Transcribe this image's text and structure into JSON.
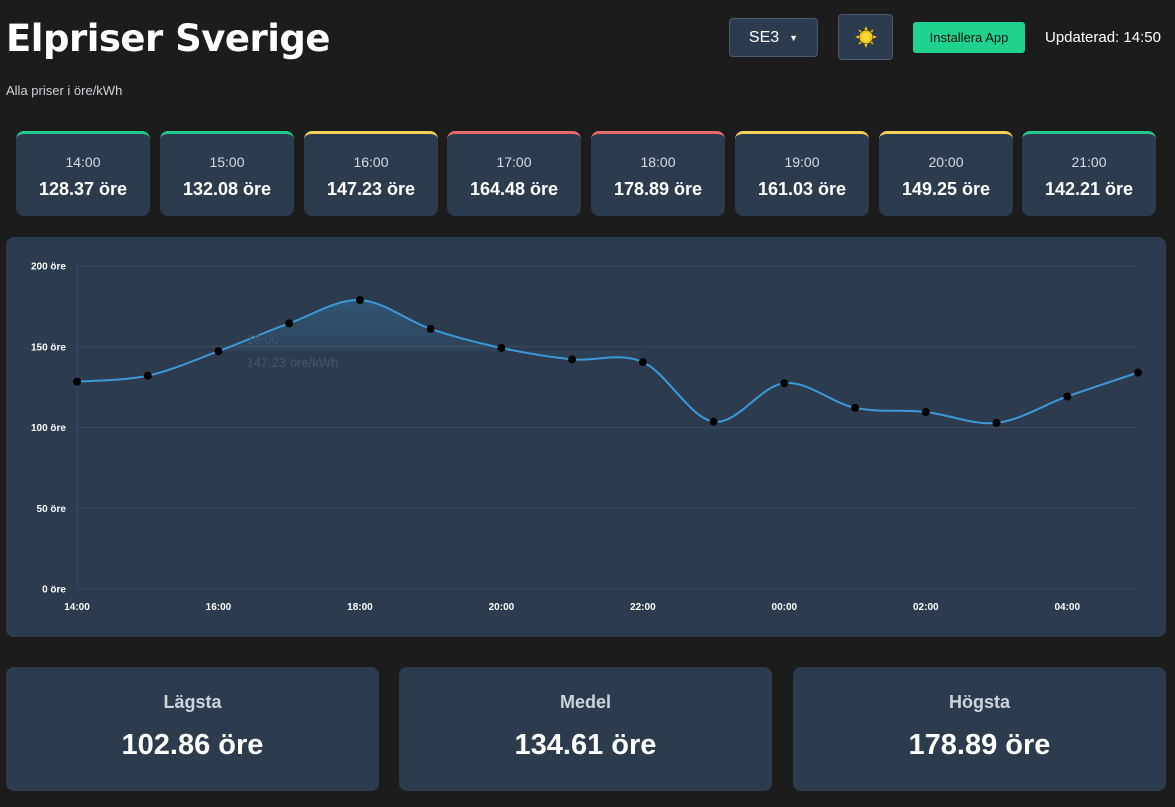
{
  "header": {
    "title": "Elpriser Sverige",
    "subtitle": "Alla priser i öre/kWh",
    "region": "SE3",
    "theme_icon": "sun-icon",
    "install_label": "Installera App",
    "updated": "Updaterad: 14:50"
  },
  "hours": [
    {
      "time": "14:00",
      "price": "128.37 öre",
      "color": "#22c98b"
    },
    {
      "time": "15:00",
      "price": "132.08 öre",
      "color": "#22c98b"
    },
    {
      "time": "16:00",
      "price": "147.23 öre",
      "color": "#f2cf55"
    },
    {
      "time": "17:00",
      "price": "164.48 öre",
      "color": "#e66a6a"
    },
    {
      "time": "18:00",
      "price": "178.89 öre",
      "color": "#e66a6a"
    },
    {
      "time": "19:00",
      "price": "161.03 öre",
      "color": "#f2cf55"
    },
    {
      "time": "20:00",
      "price": "149.25 öre",
      "color": "#f2cf55"
    },
    {
      "time": "21:00",
      "price": "142.21 öre",
      "color": "#22c98b"
    }
  ],
  "chart_data": {
    "type": "line",
    "x": [
      "14:00",
      "15:00",
      "16:00",
      "17:00",
      "18:00",
      "19:00",
      "20:00",
      "21:00",
      "22:00",
      "23:00",
      "00:00",
      "01:00",
      "02:00",
      "03:00",
      "04:00",
      "05:00"
    ],
    "values": [
      128.37,
      132.08,
      147.23,
      164.48,
      178.89,
      161.03,
      149.25,
      142.21,
      140.5,
      103.6,
      127.5,
      112.2,
      109.6,
      102.86,
      119.2,
      134.0
    ],
    "x_tick_labels": [
      "14:00",
      "16:00",
      "18:00",
      "20:00",
      "22:00",
      "00:00",
      "02:00",
      "04:00"
    ],
    "y_ticks": [
      "0 öre",
      "50 öre",
      "100 öre",
      "150 öre",
      "200 öre"
    ],
    "ylim": [
      0,
      200
    ],
    "grid": true,
    "line_color": "#3a9ad9",
    "tooltip": {
      "time": "16:00",
      "value": "147.23 öre/kWh"
    }
  },
  "stats": [
    {
      "label": "Lägsta",
      "value": "102.86 öre"
    },
    {
      "label": "Medel",
      "value": "134.61 öre"
    },
    {
      "label": "Högsta",
      "value": "178.89 öre"
    }
  ]
}
